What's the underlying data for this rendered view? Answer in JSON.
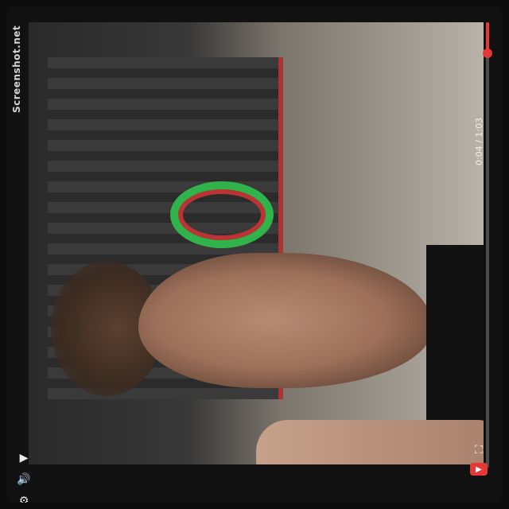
{
  "overlay": {
    "watermark": "Screenshot.net"
  },
  "controls": {
    "time_current": "0:04",
    "time_total": "1:03",
    "progress": 0.07
  },
  "icons": [
    "play-icon",
    "volume-icon",
    "settings-icon",
    "fullscreen-icon",
    "youtube-icon"
  ],
  "colors": {
    "progress": "#e53935",
    "controls_text": "#f0f0f0"
  }
}
